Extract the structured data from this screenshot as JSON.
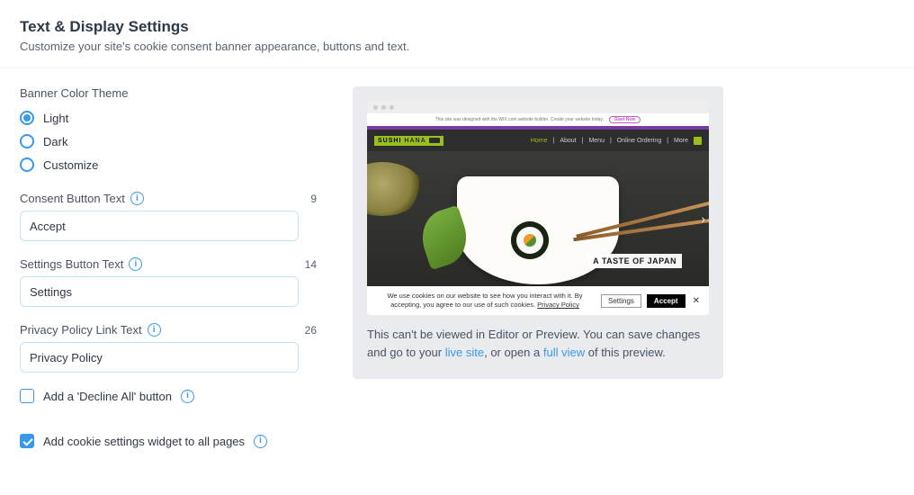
{
  "header": {
    "title": "Text & Display Settings",
    "subtitle": "Customize your site's cookie consent banner appearance, buttons and text."
  },
  "theme": {
    "section_label": "Banner Color Theme",
    "options": [
      "Light",
      "Dark",
      "Customize"
    ],
    "selected": "Light"
  },
  "consent": {
    "label": "Consent Button Text",
    "value": "Accept",
    "count": "9"
  },
  "settings_btn": {
    "label": "Settings Button Text",
    "value": "Settings",
    "count": "14"
  },
  "privacy": {
    "label": "Privacy Policy Link Text",
    "value": "Privacy Policy",
    "count": "26"
  },
  "decline": {
    "label": "Add a 'Decline All' button",
    "checked": false
  },
  "widget": {
    "label": "Add cookie settings widget to all pages",
    "checked": true
  },
  "preview": {
    "strip_text": "This site was designed with the WIX.com website builder. Create your website today.",
    "strip_btn": "Start Now",
    "logo_a": "SUSHI",
    "logo_b": "HANA",
    "nav": {
      "home": "Home",
      "about": "About",
      "menu": "Menu",
      "order": "Online Ordering",
      "more": "More"
    },
    "hero_tag": "A TASTE OF JAPAN",
    "cookie_text": "We use cookies on our website to see how you interact with it. By accepting, you agree to our use of such cookies.",
    "cookie_link": "Privacy Policy",
    "btn_settings": "Settings",
    "btn_accept": "Accept",
    "note_1": "This can't be viewed in Editor or Preview. You can save changes and go to your ",
    "note_live": "live site",
    "note_2": ", or open a ",
    "note_full": "full view",
    "note_3": " of this preview."
  }
}
